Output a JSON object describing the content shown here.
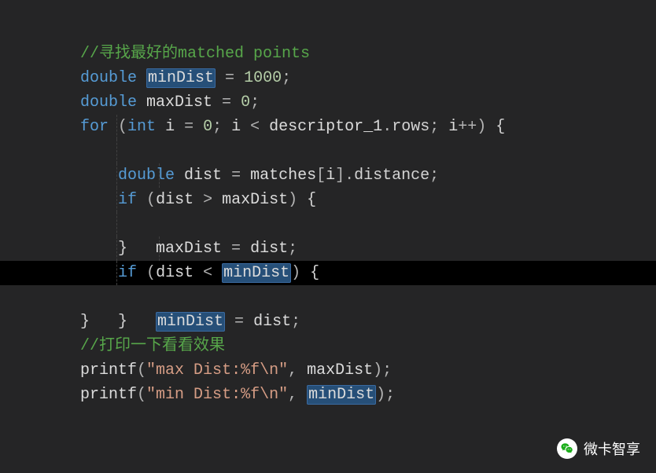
{
  "code": {
    "l1": {
      "comment": "//寻找最好的matched points"
    },
    "l2": {
      "kw": "double ",
      "var": "minDist",
      "rest": " = ",
      "num": "1000",
      "semi": ";"
    },
    "l3": {
      "kw": "double ",
      "var": "maxDist",
      "rest": " = ",
      "num": "0",
      "semi": ";"
    },
    "l4": {
      "kw1": "for ",
      "p1": "(",
      "kw2": "int ",
      "i": "i",
      "eq": " = ",
      "zero": "0",
      "semi1": "; ",
      "i2": "i",
      "lt": " < ",
      "desc": "descriptor_1",
      "dot": ".",
      "rows": "rows",
      "semi2": "; ",
      "i3": "i",
      "inc": "++",
      "p2": ") ",
      "br": "{"
    },
    "l5": {
      "indent": "    ",
      "kw": "double ",
      "var": "dist",
      "eq": " = ",
      "m": "matches",
      "b1": "[",
      "i": "i",
      "b2": "]",
      "dot": ".",
      "dist": "distance",
      "semi": ";"
    },
    "l6": {
      "indent": "    ",
      "kw": "if ",
      "p1": "(",
      "d": "dist",
      "op": " > ",
      "mx": "maxDist",
      "p2": ") ",
      "br": "{"
    },
    "l7": {
      "indent": "        ",
      "mx": "maxDist",
      "eq": " = ",
      "d": "dist",
      "semi": ";"
    },
    "l8": {
      "indent": "    ",
      "br": "}"
    },
    "l9": {
      "indent": "    ",
      "kw": "if ",
      "p1": "(",
      "d": "dist",
      "op": " < ",
      "mn": "minDist",
      "p2": ") ",
      "br": "{"
    },
    "l10": {
      "indent": "        ",
      "mn": "minDist",
      "eq": " = ",
      "d": "dist",
      "semi": ";"
    },
    "l11": {
      "indent": "    ",
      "br": "}"
    },
    "l12": {
      "br": "}"
    },
    "l13": {
      "comment": "//打印一下看看效果"
    },
    "l14": {
      "fn": "printf",
      "p1": "(",
      "str": "\"max Dist:%f\\n\"",
      "c": ", ",
      "mx": "maxDist",
      "p2": ")",
      "semi": ";"
    },
    "l15": {
      "fn": "printf",
      "p1": "(",
      "str": "\"min Dist:%f\\n\"",
      "c": ", ",
      "mn": "minDist",
      "p2": ")",
      "semi": ";"
    }
  },
  "watermark": {
    "text": "微卡智享"
  }
}
